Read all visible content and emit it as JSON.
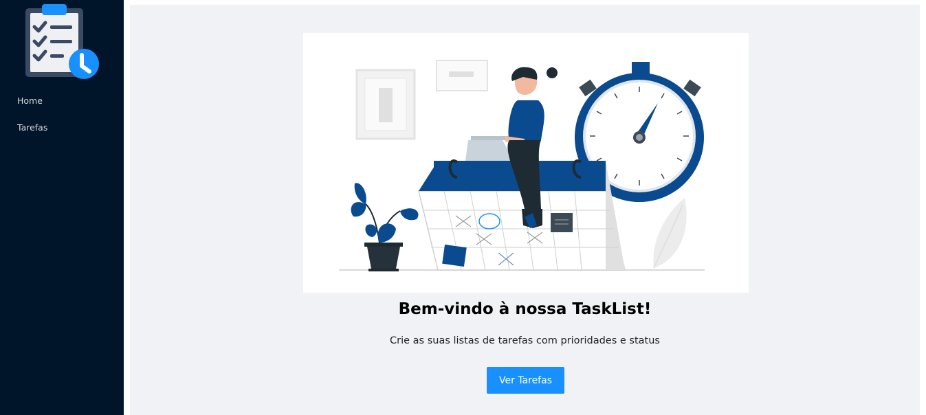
{
  "sidebar": {
    "logo_icon": "clipboard-checklist-clock-icon",
    "items": [
      {
        "label": "Home"
      },
      {
        "label": "Tarefas"
      }
    ]
  },
  "main": {
    "illustration": "woman-laptop-calendar-stopwatch-illustration",
    "title": "Bem-vindo à nossa TaskList!",
    "subtitle": "Crie as suas listas de tarefas com prioridades e status",
    "cta_label": "Ver Tarefas"
  },
  "colors": {
    "sidebar_bg": "#001529",
    "content_bg": "#f0f2f5",
    "primary": "#1890ff",
    "illustration_blue": "#0a4a8f"
  }
}
